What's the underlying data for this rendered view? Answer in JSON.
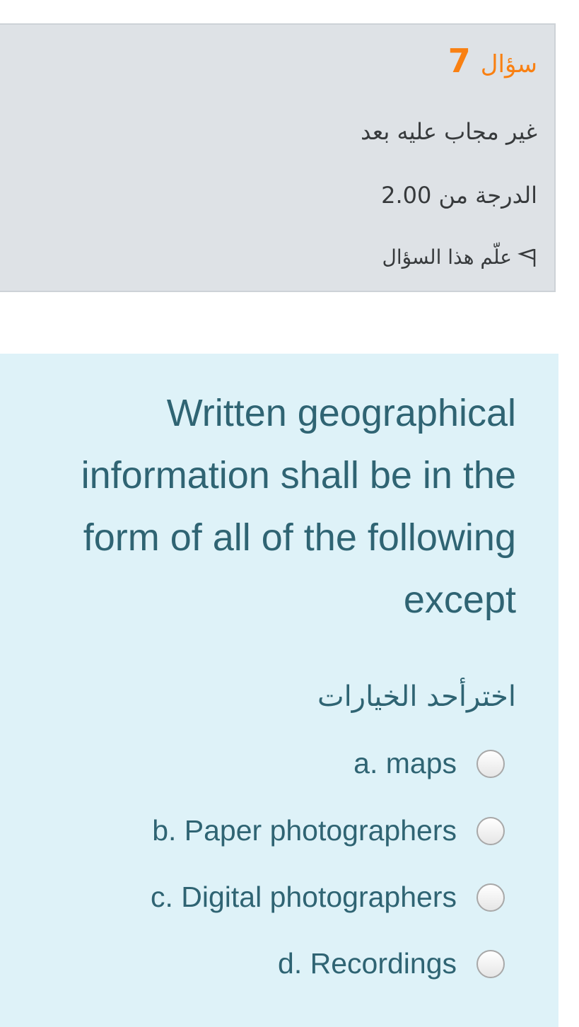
{
  "info": {
    "question_word": "سؤال",
    "question_number": "7",
    "status": "غير مجاب عليه بعد",
    "grade": "الدرجة من 2.00",
    "flag_label": "علّم هذا السؤال"
  },
  "question": {
    "text": "Written geographical information shall be in the form of all of the following except",
    "prompt": "اخترأحد الخيارات",
    "options": [
      {
        "label": "a. maps"
      },
      {
        "label": "b. Paper photographers"
      },
      {
        "label": "c. Digital photographers"
      },
      {
        "label": "d. Recordings"
      }
    ]
  },
  "colors": {
    "accent": "#f98012",
    "question_bg": "#def2f8",
    "info_bg": "#dee2e6",
    "question_text": "#2f6473"
  },
  "icons": {
    "flag": "flag-icon",
    "radio": "radio-icon"
  }
}
